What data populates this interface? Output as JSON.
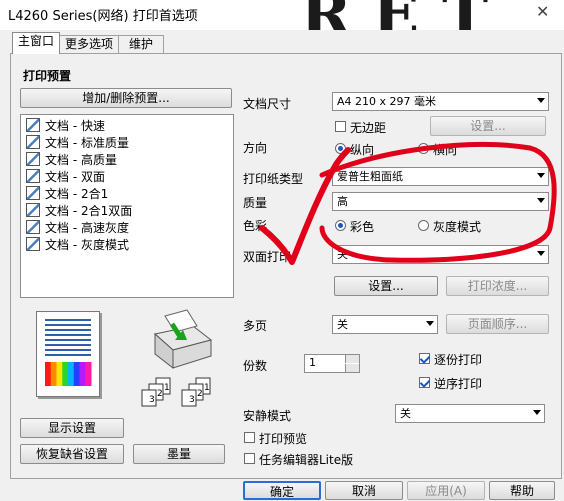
{
  "window": {
    "title": "L4260 Series(网络) 打印首选项",
    "bg_letters": "RET",
    "close_glyph": "✕"
  },
  "tabs": [
    {
      "label": "主窗口"
    },
    {
      "label": "更多选项"
    },
    {
      "label": "维护"
    }
  ],
  "presets": {
    "heading": "打印预置",
    "add_remove_button": "增加/删除预置...",
    "items": [
      {
        "label": "文档 - 快速"
      },
      {
        "label": "文档 - 标准质量"
      },
      {
        "label": "文档 - 高质量"
      },
      {
        "label": "文档 - 双面"
      },
      {
        "label": "文档 - 2合1"
      },
      {
        "label": "文档 - 2合1双面"
      },
      {
        "label": "文档 - 高速灰度"
      },
      {
        "label": "文档 - 灰度模式"
      }
    ]
  },
  "preview": {
    "rainbow_colors": [
      "#ff1a1a",
      "#ff8a00",
      "#ffe600",
      "#2bd62b",
      "#00b7ff",
      "#2a3cff",
      "#b21bff",
      "#ff1aa8"
    ],
    "stack_labels": [
      "3",
      "2",
      "1"
    ]
  },
  "settings": {
    "doc_size_label": "文档尺寸",
    "doc_size_value": "A4 210 x 297 毫米",
    "borderless_label": "无边距",
    "borderless_checked": false,
    "settings_button_top": "设置...",
    "orientation_label": "方向",
    "orientation_portrait": "纵向",
    "orientation_landscape": "横向",
    "paper_type_label": "打印纸类型",
    "paper_type_value": "爱普生粗面纸",
    "quality_label": "质量",
    "quality_value": "高",
    "color_label": "色彩",
    "color_option": "彩色",
    "grayscale_option": "灰度模式",
    "duplex_label": "双面打印",
    "duplex_value": "关",
    "duplex_settings_button": "设置...",
    "density_button": "打印浓度...",
    "multipage_label": "多页",
    "multipage_value": "关",
    "page_order_button": "页面顺序...",
    "copies_label": "份数",
    "copies_value": "1",
    "collate_label": "逐份打印",
    "collate_checked": true,
    "reverse_label": "逆序打印",
    "reverse_checked": true,
    "quiet_label": "安静模式",
    "quiet_value": "关",
    "print_preview_label": "打印预览",
    "job_arranger_label": "任务编辑器Lite版"
  },
  "left_buttons": {
    "show_settings": "显示设置",
    "restore_defaults": "恢复缺省设置",
    "ink_levels": "墨量"
  },
  "footer": {
    "ok": "确定",
    "cancel": "取消",
    "apply": "应用(A)",
    "help": "帮助"
  },
  "annotation_color": "#e0001a"
}
